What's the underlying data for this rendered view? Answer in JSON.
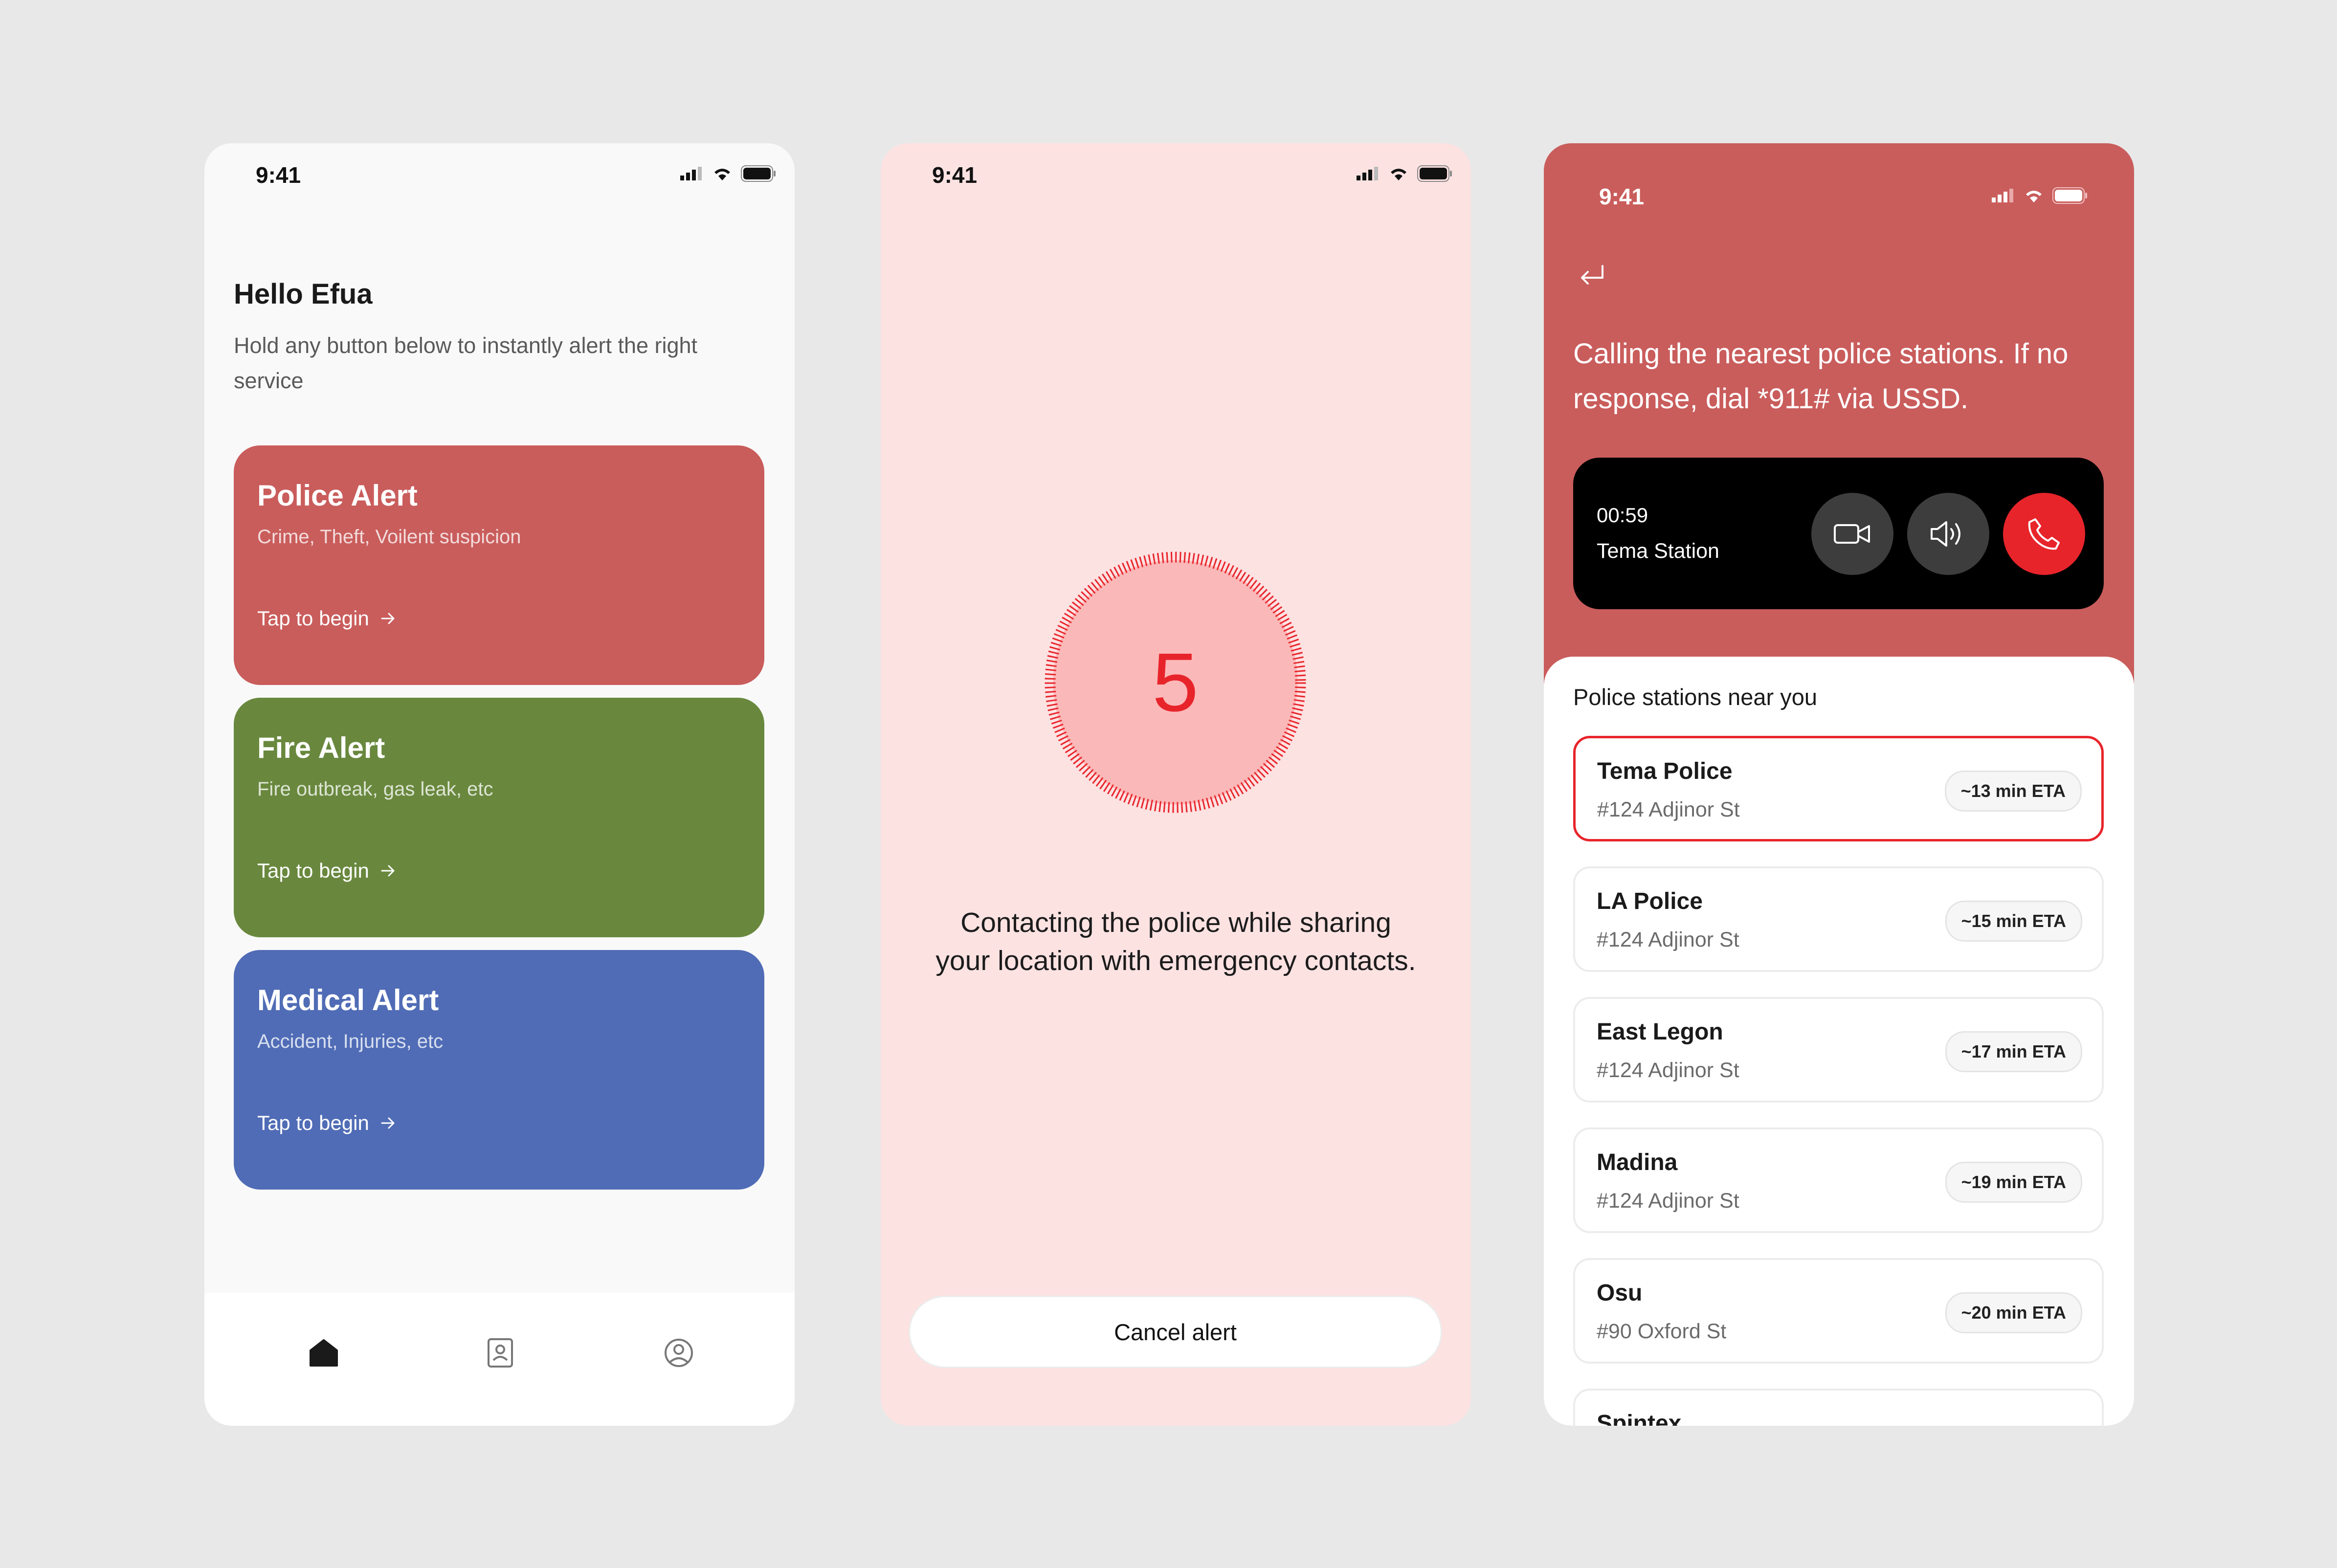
{
  "screens": {
    "home": {
      "time": "9:41",
      "greeting": "Hello Efua",
      "subtitle": "Hold any button below to instantly alert the right service",
      "cards": [
        {
          "title": "Police Alert",
          "desc": "Crime, Theft, Voilent suspicion",
          "cta": "Tap to begin",
          "color": "#c95d5c"
        },
        {
          "title": "Fire Alert",
          "desc": "Fire outbreak, gas leak, etc",
          "cta": "Tap to begin",
          "color": "#69883e"
        },
        {
          "title": "Medical Alert",
          "desc": "Accident, Injuries, etc",
          "cta": "Tap to begin",
          "color": "#506cb6"
        }
      ],
      "tabs": [
        "home-icon",
        "contacts-book-icon",
        "profile-icon"
      ]
    },
    "countdown": {
      "time": "9:41",
      "count": "5",
      "message": "Contacting the police while sharing your location with emergency contacts.",
      "cancel_label": "Cancel alert"
    },
    "calling": {
      "time": "9:41",
      "message": "Calling the nearest police stations. If no response, dial *911# via USSD.",
      "call": {
        "timer": "00:59",
        "station": "Tema Station"
      },
      "list_title": "Police stations near you",
      "stations": [
        {
          "name": "Tema Police",
          "address": "#124 Adjinor St",
          "eta": "~13 min ETA"
        },
        {
          "name": "LA Police",
          "address": "#124 Adjinor St",
          "eta": "~15 min ETA"
        },
        {
          "name": "East Legon",
          "address": "#124 Adjinor St",
          "eta": "~17 min ETA"
        },
        {
          "name": "Madina",
          "address": "#124 Adjinor St",
          "eta": "~19 min ETA"
        },
        {
          "name": "Osu",
          "address": "#90 Oxford St",
          "eta": "~20 min ETA"
        },
        {
          "name": "Spintex",
          "address": "",
          "eta": ""
        }
      ]
    }
  },
  "colors": {
    "accent_red": "#e8242b",
    "police": "#c95d5c",
    "fire": "#69883e",
    "medical": "#506cb6",
    "countdown_bg": "#fde2e2"
  }
}
